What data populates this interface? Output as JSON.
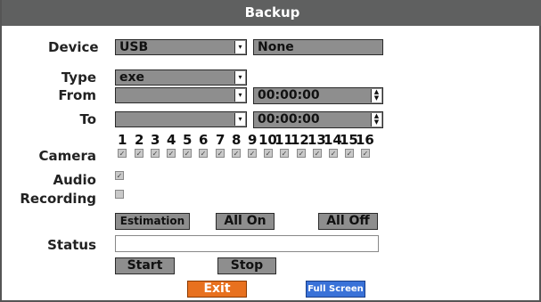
{
  "window": {
    "title": "Backup"
  },
  "labels": {
    "device": "Device",
    "type": "Type",
    "from": "From",
    "to": "To",
    "camera": "Camera",
    "audio": "Audio",
    "recording": "Recording",
    "status": "Status"
  },
  "device": {
    "value": "USB",
    "secondary": "None"
  },
  "type": {
    "value": "exe"
  },
  "from": {
    "date": "",
    "time": "00:00:00"
  },
  "to": {
    "date": "",
    "time": "00:00:00"
  },
  "cameras": [
    "1",
    "2",
    "3",
    "4",
    "5",
    "6",
    "7",
    "8",
    "9",
    "10",
    "11",
    "12",
    "13",
    "14",
    "15",
    "16"
  ],
  "camera_checked": [
    true,
    true,
    true,
    true,
    true,
    true,
    true,
    true,
    true,
    true,
    true,
    true,
    true,
    true,
    true,
    true
  ],
  "audio_checked": true,
  "recording_checked": false,
  "buttons": {
    "estimation": "Estimation",
    "all_on": "All On",
    "all_off": "All Off",
    "start": "Start",
    "stop": "Stop",
    "exit": "Exit",
    "full_screen": "Full Screen"
  },
  "status": {
    "value": ""
  },
  "colors": {
    "exit_bg": "#e8711f",
    "fullscreen_bg": "#3a72d8",
    "title_bg": "#5f6060",
    "field_bg": "#8e8e8e"
  }
}
